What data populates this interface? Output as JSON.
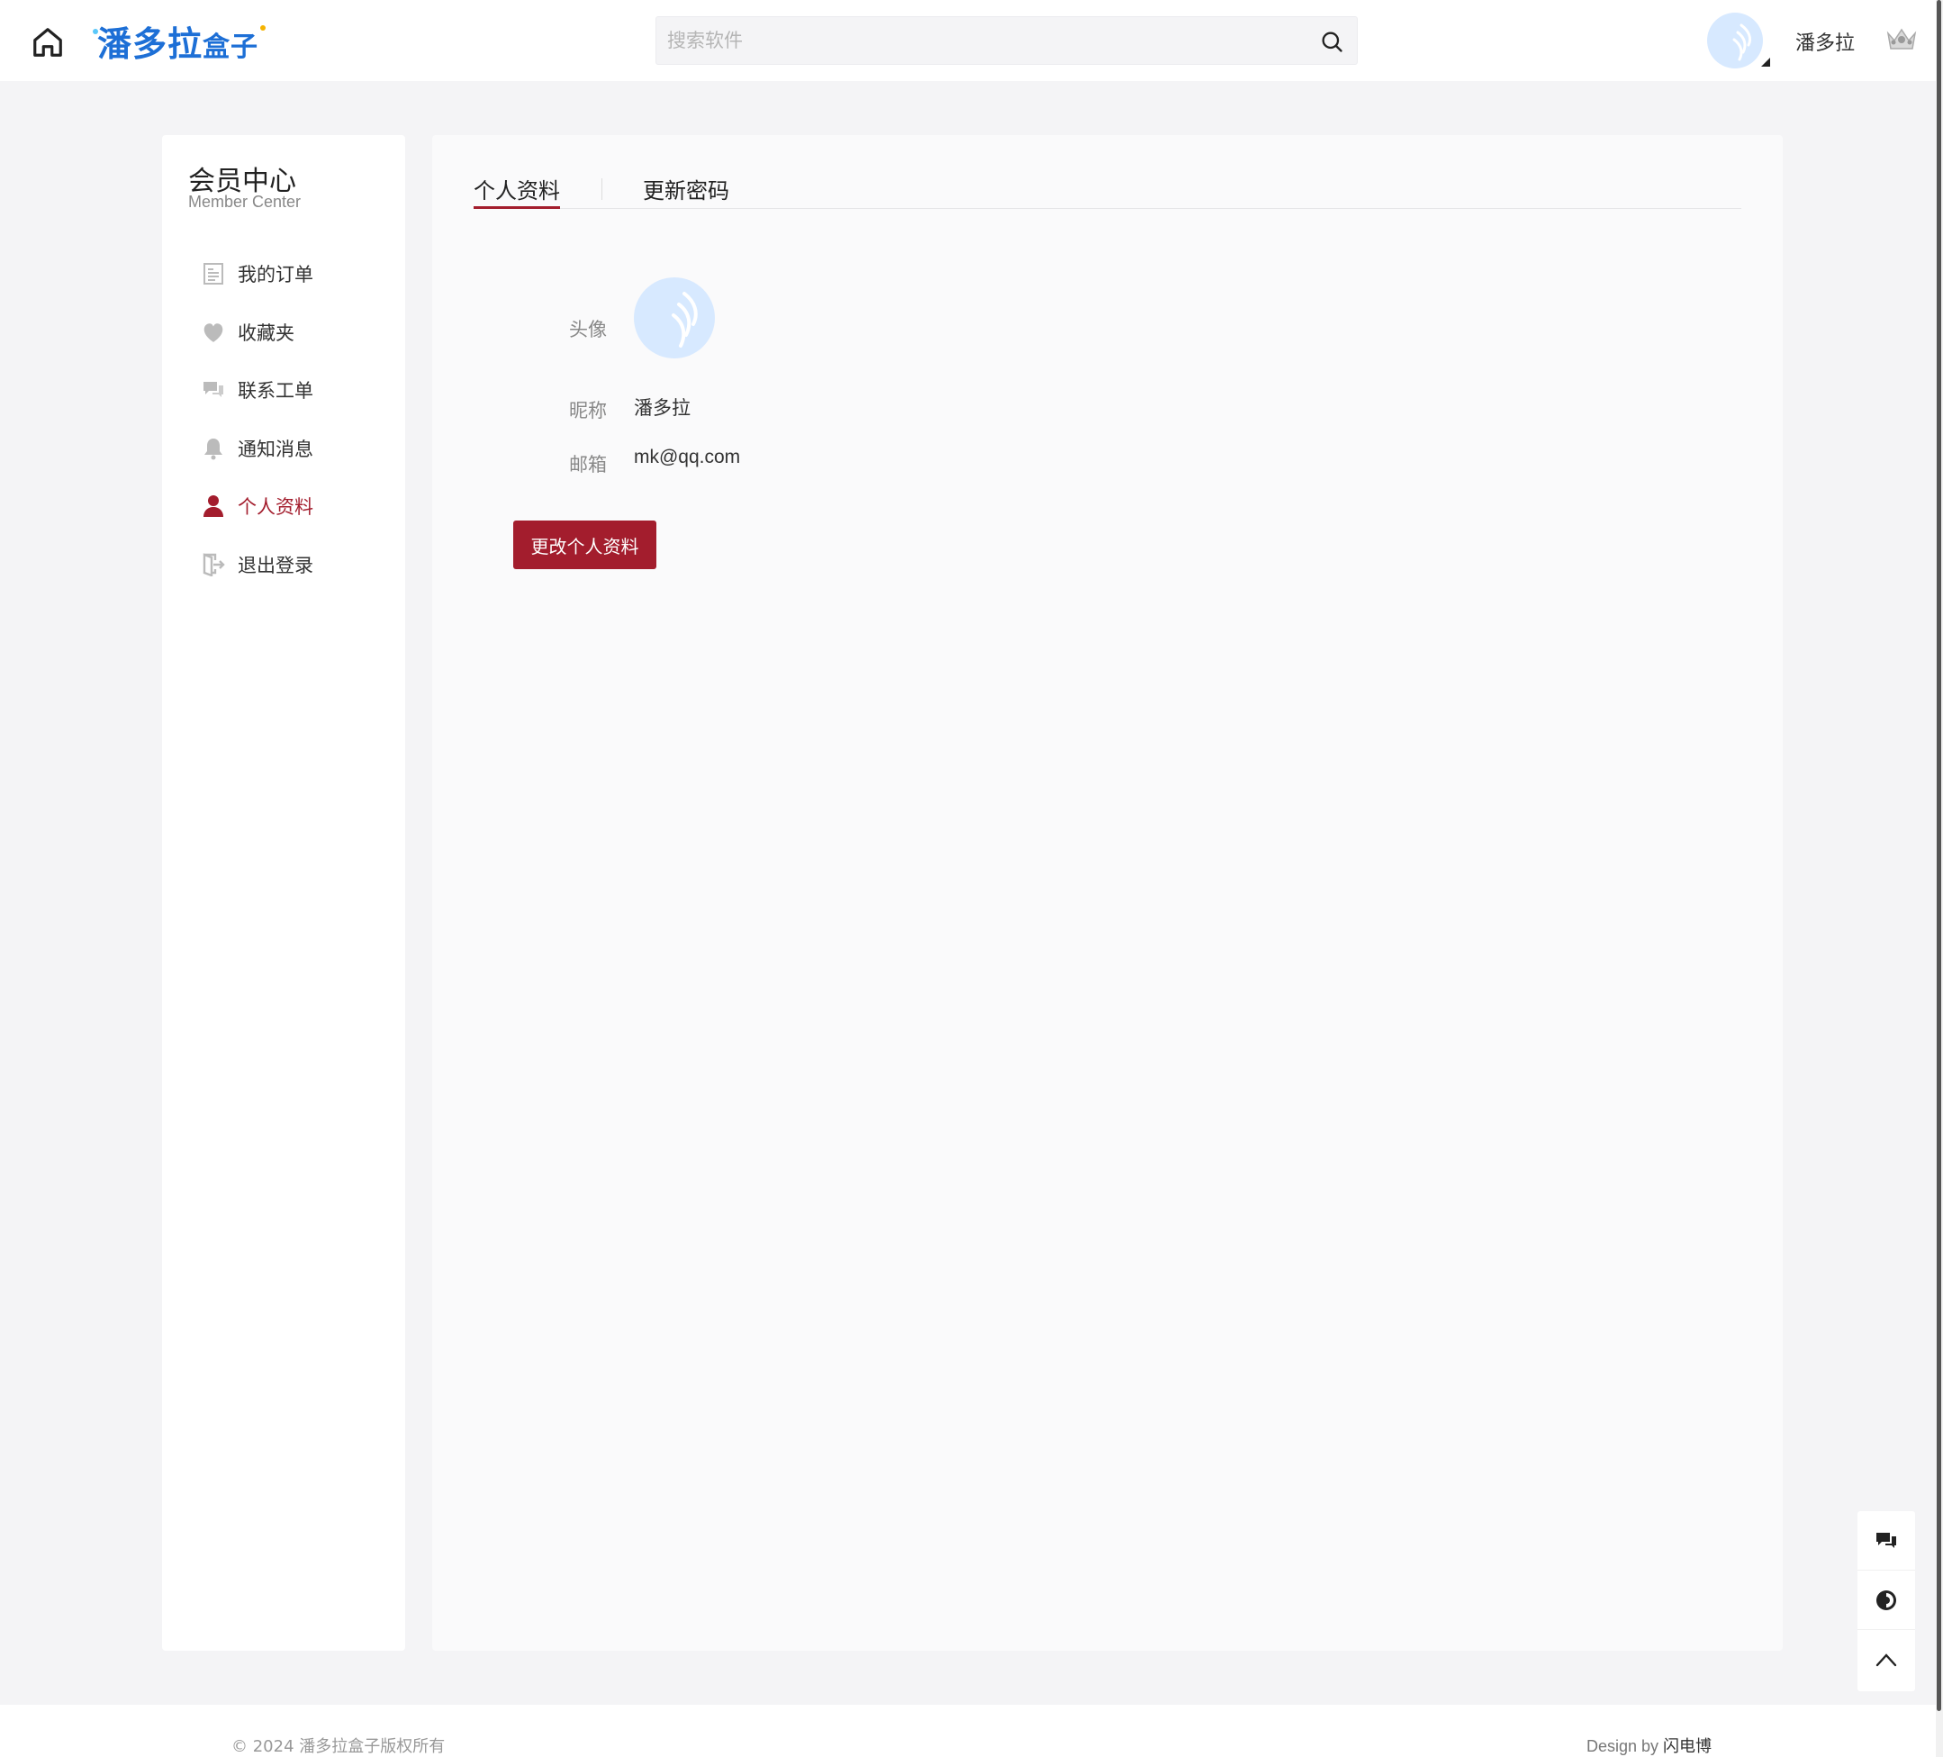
{
  "header": {
    "logo_text": "潘多拉",
    "logo_text_small": "盒子",
    "search_placeholder": "搜索软件",
    "username": "潘多拉"
  },
  "sidebar": {
    "title": "会员中心",
    "subtitle": "Member Center",
    "items": [
      {
        "label": "我的订单",
        "icon": "order-list-icon",
        "active": false
      },
      {
        "label": "收藏夹",
        "icon": "heart-icon",
        "active": false
      },
      {
        "label": "联系工单",
        "icon": "chat-icon",
        "active": false
      },
      {
        "label": "通知消息",
        "icon": "bell-icon",
        "active": false
      },
      {
        "label": "个人资料",
        "icon": "user-icon",
        "active": true
      },
      {
        "label": "退出登录",
        "icon": "logout-icon",
        "active": false
      }
    ]
  },
  "main": {
    "tabs": [
      {
        "label": "个人资料",
        "active": true
      },
      {
        "label": "更新密码",
        "active": false
      }
    ],
    "avatar_label": "头像",
    "nickname_label": "昵称",
    "nickname_value": "潘多拉",
    "email_label": "邮箱",
    "email_value": "mk@qq.com",
    "edit_button_label": "更改个人资料"
  },
  "float_tools": [
    "chat-bubble-icon",
    "theme-toggle-icon",
    "back-to-top-icon"
  ],
  "footer": {
    "copyright": "© 2024 潘多拉盒子版权所有",
    "design_prefix": "Design by ",
    "design_author": "闪电博"
  },
  "colors": {
    "accent": "#a31d2d",
    "logo_blue": "#1d6fd6",
    "avatar_bg": "#d7e9ff"
  }
}
